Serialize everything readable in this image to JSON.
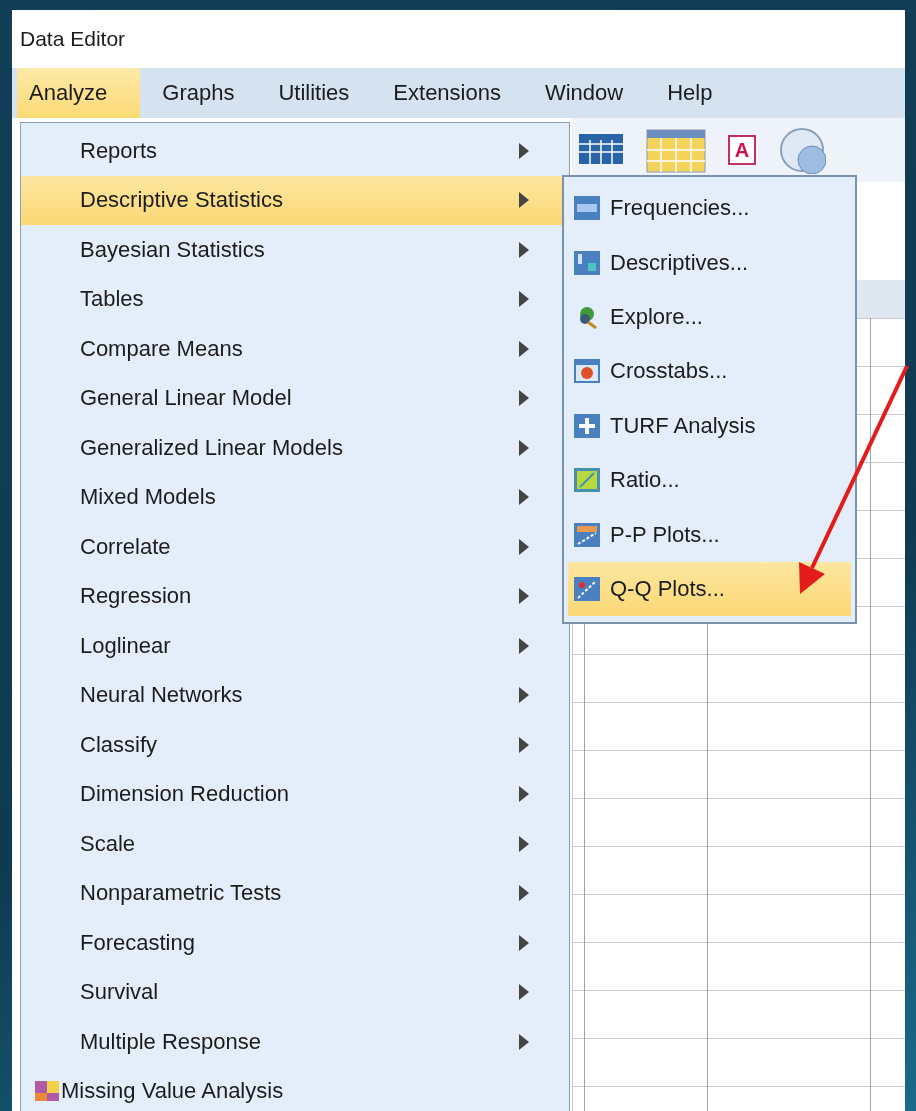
{
  "window": {
    "title": "Data Editor"
  },
  "menubar": [
    {
      "label": "Analyze",
      "selected": true
    },
    {
      "label": "Graphs",
      "selected": false
    },
    {
      "label": "Utilities",
      "selected": false
    },
    {
      "label": "Extensions",
      "selected": false
    },
    {
      "label": "Window",
      "selected": false
    },
    {
      "label": "Help",
      "selected": false
    }
  ],
  "toolbar": [
    {
      "kind": "grid"
    },
    {
      "kind": "table"
    },
    {
      "kind": "text-style",
      "glyph": "A"
    },
    {
      "kind": "circle"
    }
  ],
  "menu": {
    "items": [
      {
        "label": "Reports",
        "kind": "submenu",
        "selected": false
      },
      {
        "label": "Descriptive Statistics",
        "kind": "submenu",
        "selected": true
      },
      {
        "label": "Bayesian Statistics",
        "kind": "submenu",
        "selected": false
      },
      {
        "label": "Tables",
        "kind": "submenu",
        "selected": false
      },
      {
        "label": "Compare Means",
        "kind": "submenu",
        "selected": false
      },
      {
        "label": "General Linear Model",
        "kind": "submenu",
        "selected": false
      },
      {
        "label": "Generalized Linear Models",
        "kind": "submenu",
        "selected": false
      },
      {
        "label": "Mixed Models",
        "kind": "submenu",
        "selected": false
      },
      {
        "label": "Correlate",
        "kind": "submenu",
        "selected": false
      },
      {
        "label": "Regression",
        "kind": "submenu",
        "selected": false
      },
      {
        "label": "Loglinear",
        "kind": "submenu",
        "selected": false
      },
      {
        "label": "Neural Networks",
        "kind": "submenu",
        "selected": false
      },
      {
        "label": "Classify",
        "kind": "submenu",
        "selected": false
      },
      {
        "label": "Dimension Reduction",
        "kind": "submenu",
        "selected": false
      },
      {
        "label": "Scale",
        "kind": "submenu",
        "selected": false
      },
      {
        "label": "Nonparametric Tests",
        "kind": "submenu",
        "selected": false
      },
      {
        "label": "Forecasting",
        "kind": "submenu",
        "selected": false
      },
      {
        "label": "Survival",
        "kind": "submenu",
        "selected": false
      },
      {
        "label": "Multiple Response",
        "kind": "submenu",
        "selected": false
      },
      {
        "label": "Missing Value Analysis",
        "kind": "command",
        "selected": false
      }
    ]
  },
  "submenu": {
    "items": [
      {
        "label": "Frequencies...",
        "kind": "frequencies",
        "selected": false
      },
      {
        "label": "Descriptives...",
        "kind": "descriptives",
        "selected": false
      },
      {
        "label": "Explore...",
        "kind": "explore",
        "selected": false
      },
      {
        "label": "Crosstabs...",
        "kind": "crosstabs",
        "selected": false
      },
      {
        "label": "TURF Analysis",
        "kind": "turf",
        "selected": false
      },
      {
        "label": "Ratio...",
        "kind": "ratio",
        "selected": false
      },
      {
        "label": "P-P Plots...",
        "kind": "pp",
        "selected": false
      },
      {
        "label": "Q-Q Plots...",
        "kind": "qq",
        "selected": true
      }
    ]
  },
  "annotation": {
    "kind": "arrow"
  }
}
